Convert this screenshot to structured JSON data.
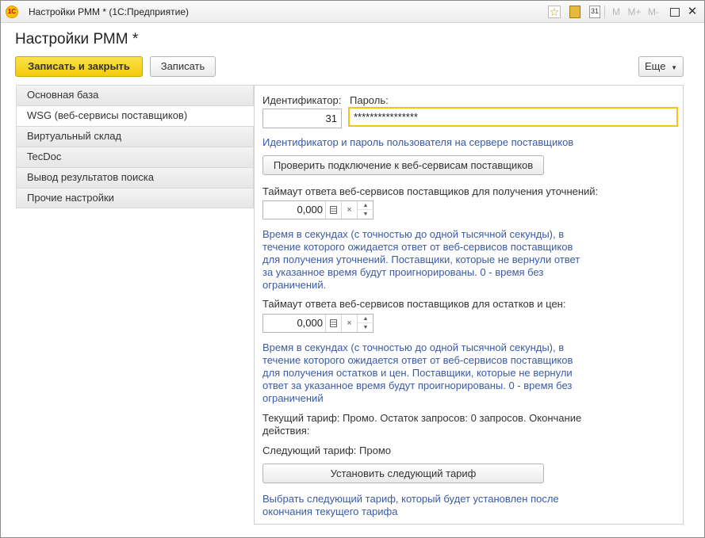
{
  "window": {
    "title": "Настройки РММ * (1С:Предприятие)",
    "toolbar": {
      "m": "M",
      "m_plus": "M+",
      "m_minus": "M-"
    }
  },
  "form": {
    "title": "Настройки РММ *",
    "buttons": {
      "save_close": "Записать и закрыть",
      "save": "Записать",
      "more": "Еще"
    }
  },
  "nav": {
    "items": [
      {
        "label": "Основная база",
        "active": false
      },
      {
        "label": "WSG (веб-сервисы поставщиков)",
        "active": true
      },
      {
        "label": "Виртуальный склад",
        "active": false
      },
      {
        "label": "TecDoc",
        "active": false
      },
      {
        "label": "Вывод результатов поиска",
        "active": false
      },
      {
        "label": "Прочие настройки",
        "active": false
      }
    ]
  },
  "panel": {
    "id_label": "Идентификатор:",
    "id_value": "31",
    "password_label": "Пароль:",
    "password_value": "****************",
    "credentials_hint": "Идентификатор и пароль пользователя на сервере поставщиков",
    "check_button": "Проверить подключение к веб-сервисам поставщиков",
    "timeout1_label": "Таймаут ответа веб-сервисов поставщиков для получения уточнений:",
    "timeout1_value": "0,000",
    "timeout1_hint": [
      "Время в секундах (с точностью до одной тысячной секунды), в",
      "течение которого ожидается ответ от веб-сервисов поставщиков",
      "для получения уточнений. Поставщики, которые не вернули ответ",
      "за указанное время будут проигнорированы. 0 - время без",
      "ограничений."
    ],
    "timeout2_label": "Таймаут ответа веб-сервисов поставщиков для остатков и цен:",
    "timeout2_value": "0,000",
    "timeout2_hint": [
      "Время в секундах (с точностью до одной тысячной секунды), в",
      "течение которого ожидается ответ от веб-сервисов поставщиков",
      "для получения остатков и цен. Поставщики, которые не вернули",
      "ответ за указанное время будут проигнорированы. 0 - время без",
      "ограничений"
    ],
    "current_tariff": [
      "Текущий тариф: Промо. Остаток запросов: 0 запросов. Окончание",
      "действия:"
    ],
    "next_tariff": "Следующий тариф: Промо",
    "set_tariff_button": "Установить следующий тариф",
    "tariff_hint": [
      "Выбрать следующий тариф, который будет установлен после",
      "окончания текущего тарифа"
    ]
  },
  "icons": {
    "app": "1c-logo-icon",
    "favorite": "star-icon",
    "calculator": "calculator-icon",
    "calendar": "calendar-icon",
    "minimize": "minimize-icon",
    "maximize": "maximize-icon",
    "close": "close-icon"
  },
  "colors": {
    "accent_yellow": "#f3cb0c",
    "hint_blue": "#3a5aa8",
    "focus_border": "#f2c511"
  }
}
